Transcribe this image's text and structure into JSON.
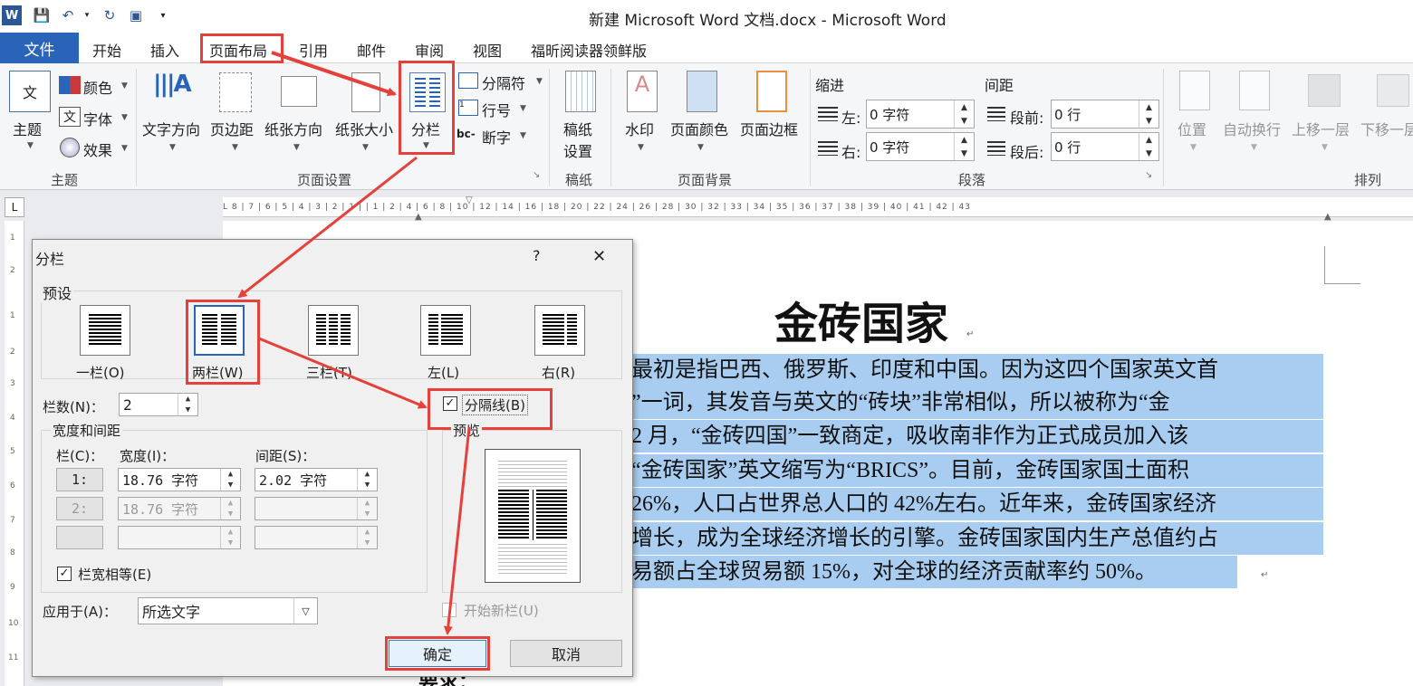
{
  "window": {
    "title": "新建 Microsoft Word 文档.docx - Microsoft Word"
  },
  "tabs": [
    {
      "label": "文件"
    },
    {
      "label": "开始"
    },
    {
      "label": "插入"
    },
    {
      "label": "页面布局"
    },
    {
      "label": "引用"
    },
    {
      "label": "邮件"
    },
    {
      "label": "审阅"
    },
    {
      "label": "视图"
    },
    {
      "label": "福昕阅读器领鲜版"
    }
  ],
  "ribbon": {
    "theme_group": {
      "label": "主题",
      "themes_btn": "主题",
      "colors": "颜色",
      "fonts": "字体",
      "effects": "效果"
    },
    "page_setup": {
      "label": "页面设置",
      "text_direction": "文字方向",
      "margins": "页边距",
      "orientation": "纸张方向",
      "size": "纸张大小",
      "columns": "分栏",
      "breaks": "分隔符",
      "line_numbers": "行号",
      "hyphenation": "断字"
    },
    "manuscript": {
      "label": "稿纸",
      "btn": "稿纸\n设置",
      "btn_l1": "稿纸",
      "btn_l2": "设置"
    },
    "page_background": {
      "label": "页面背景",
      "watermark": "水印",
      "page_color": "页面颜色",
      "page_borders": "页面边框"
    },
    "paragraph": {
      "label": "段落",
      "indent": "缩进",
      "spacing": "间距",
      "left": "左:",
      "right": "右:",
      "left_value": "0 字符",
      "right_value": "0 字符",
      "before": "段前:",
      "after": "段后:",
      "before_value": "0 行",
      "after_value": "0 行"
    },
    "arrange": {
      "label": "排列",
      "position": "位置",
      "wrap": "自动换行",
      "forward": "上移一层",
      "backward": "下移一层"
    }
  },
  "ruler": {
    "marks": "L 8 | 7 | 6 | 5 | 4 | 3 | 2 | 1 |   | 1 | 2 | 4 | 6 | 8 | 10 | 12 | 14 | 16 | 18 | 20 | 22 | 24 | 26 | 28 | 30 | 32 | 33 | 34 | 35 | 36 | 37 | 38 | 39 | 40 | 41 | 42 | 43"
  },
  "vruler": {
    "marks": [
      "1",
      "2",
      "1",
      "2",
      "3",
      "4",
      "5",
      "6",
      "7",
      "8",
      "9",
      "10",
      "11"
    ]
  },
  "document": {
    "title": "金砖国家",
    "lines": [
      "最初是指巴西、俄罗斯、印度和中国。因为这四个国家英文首",
      "”一词，其发音与英文的“砖块”非常相似，所以被称为“金",
      "2 月，“金砖四国”一致商定，吸收南非作为正式成员加入该",
      "“金砖国家”英文缩写为“BRICS”。目前，金砖国家国土面积",
      "26%，人口占世界总人口的 42%左右。近年来，金砖国家经济",
      "增长，成为全球经济增长的引擎。金砖国家国内生产总值约占",
      "易额占全球贸易额 15%，对全球的经济贡献率约 50%。"
    ],
    "footer_partial": "要求："
  },
  "dialog": {
    "title": "分栏",
    "help": "?",
    "close": "✕",
    "presets_label": "预设",
    "presets": [
      "一栏(O)",
      "两栏(W)",
      "三栏(T)",
      "左(L)",
      "右(R)"
    ],
    "num_cols_label": "栏数(N)：",
    "num_cols": "2",
    "line_between": "分隔线(B)",
    "width_spacing_label": "宽度和间距",
    "col_header": "栏(C)：",
    "width_header": "宽度(I)：",
    "spacing_header": "间距(S)：",
    "rows": [
      {
        "col": "1:",
        "width": "18.76 字符",
        "spacing": "2.02 字符"
      },
      {
        "col": "2:",
        "width": "18.76 字符",
        "spacing": ""
      }
    ],
    "equal_width": "栏宽相等(E)",
    "apply_to_label": "应用于(A)：",
    "apply_to_value": "所选文字",
    "preview_label": "预览",
    "start_new_col": "开始新栏(U)",
    "ok": "确定",
    "cancel": "取消"
  },
  "colors": {
    "file_tab": "#2a64b8",
    "highlight": "#a8cdf0",
    "annotation": "#e5403a"
  }
}
